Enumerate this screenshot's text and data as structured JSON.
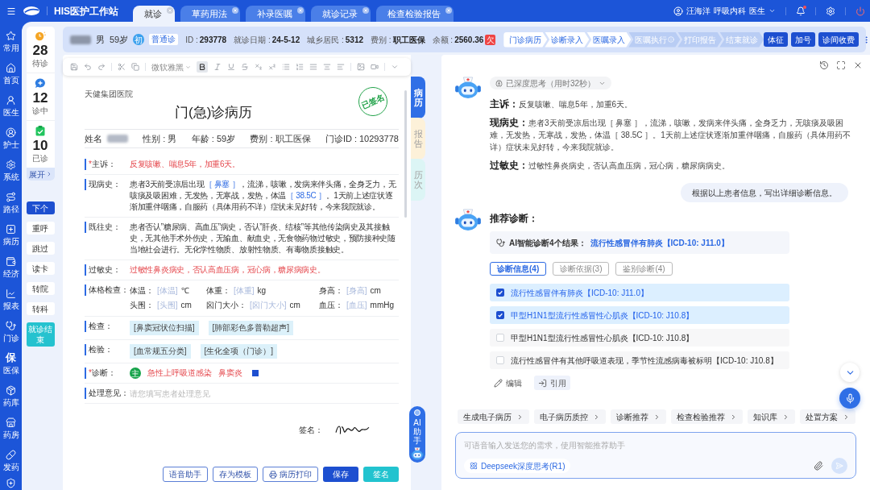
{
  "app": {
    "title": "HIS医护工作站"
  },
  "tabs": [
    {
      "label": "就诊",
      "selected": true
    },
    {
      "label": "草药用法",
      "selected": false
    },
    {
      "label": "补录医嘱",
      "selected": false
    },
    {
      "label": "就诊记录",
      "selected": false
    },
    {
      "label": "检查检验报告",
      "selected": false
    }
  ],
  "user": {
    "name": "汪海洋",
    "department": "呼吸内科",
    "role": "医生",
    "has_alert": true
  },
  "nav": [
    {
      "label": "常用"
    },
    {
      "label": "首页"
    },
    {
      "label": "医生"
    },
    {
      "label": "护士"
    },
    {
      "label": "系统"
    },
    {
      "label": "路径"
    },
    {
      "label": "病历"
    },
    {
      "label": "经济"
    },
    {
      "label": "报表"
    },
    {
      "label": "门诊"
    },
    {
      "label": "医保",
      "glyph": "保"
    },
    {
      "label": "药库"
    },
    {
      "label": "药房"
    },
    {
      "label": "发药"
    }
  ],
  "queue": {
    "stats": [
      {
        "count": "28",
        "label": "待诊"
      },
      {
        "count": "12",
        "label": "诊中"
      },
      {
        "count": "10",
        "label": "已诊"
      }
    ],
    "expand": "展开",
    "actions": [
      {
        "label": "下个",
        "kind": "primary"
      },
      {
        "label": "重呼",
        "kind": "plain"
      },
      {
        "label": "跳过",
        "kind": "plain"
      },
      {
        "label": "读卡",
        "kind": "plain"
      },
      {
        "label": "转院",
        "kind": "plain"
      },
      {
        "label": "转科",
        "kind": "plain"
      },
      {
        "label": "就诊结束",
        "kind": "finish"
      }
    ]
  },
  "patient": {
    "gender": "男",
    "age": "59岁",
    "visit_badge": "初",
    "visit_type": "普通诊",
    "fields": [
      {
        "label": "ID :",
        "value": "293778"
      },
      {
        "label": "就诊日期 :",
        "value": "24-5-12"
      },
      {
        "label": "城乡居民 :",
        "value": "5312"
      },
      {
        "label": "费别 :",
        "value": "职工医保"
      },
      {
        "label": "余额 :",
        "value": "2560.36"
      }
    ],
    "balance_badge": "欠"
  },
  "steps": [
    {
      "label": "门诊病历",
      "done": true,
      "info": false
    },
    {
      "label": "诊断录入",
      "done": true,
      "info": false
    },
    {
      "label": "医嘱录入",
      "done": true,
      "info": false
    },
    {
      "label": "医嘱执行",
      "done": false,
      "info": true
    },
    {
      "label": "打印报告",
      "done": false,
      "info": false
    },
    {
      "label": "结束就诊",
      "done": false,
      "info": false
    }
  ],
  "header_buttons": [
    "体征",
    "加号",
    "诊间收费"
  ],
  "toolbar": {
    "font": "微软雅黑",
    "bold": true
  },
  "document": {
    "hospital": "天健集团医院",
    "title": "门(急)诊病历",
    "stamp": "已签名",
    "info": [
      {
        "label": "姓名",
        "kind": "redacted"
      },
      {
        "label": "性别 :",
        "value": "男",
        "kind": "text"
      },
      {
        "label": "年龄 :",
        "value": "59岁",
        "kind": "text"
      },
      {
        "label": "费别 :",
        "value": "职工医保",
        "kind": "text"
      },
      {
        "label": "门诊ID :",
        "value": "10293778",
        "kind": "text"
      }
    ],
    "sections": [
      {
        "label": "主诉：",
        "required_mark": "*",
        "kind": "text",
        "alert": true,
        "text": "反复咳嗽、喘息5年，加重6天。"
      },
      {
        "label": "现病史：",
        "kind": "segments",
        "segments": [
          {
            "text": "患者3天前受凉后出现",
            "field": false
          },
          {
            "text": "［ 鼻塞 ］",
            "field": true
          },
          {
            "text": "，流涕，咳嗽，发病来伴头痛，全身乏力，无咳痰及吸困难，无发热，无寒战，发热，体温",
            "field": false
          },
          {
            "text": "［ 38.5C ］",
            "field": true
          },
          {
            "text": "。1天前上述症状逐渐加重伴咽痛，自服药（具体用药不详）症状未见好转，今来我院就诊。",
            "field": false
          }
        ]
      },
      {
        "label": "既往史：",
        "kind": "text",
        "alert": false,
        "text": "患者否认”糖尿病、高血压”病史，否认”肝炎、结核”等其他传染病史及其接触史，无其他手术外伤史，无输血、献血史，无食物药物过敏史，预防接种史随当地社会进行。无化学性物质、放射性物质、有毒物质接触史。"
      },
      {
        "label": "过敏史：",
        "kind": "text",
        "alert": true,
        "text": "过敏性鼻炎病史，否认高血压病，冠心病，糖尿病病史。"
      },
      {
        "label": "体格检查：",
        "kind": "vitals",
        "items": [
          {
            "label": "体温：",
            "placeholder": "[体温]",
            "unit": "℃"
          },
          {
            "label": "体重：",
            "placeholder": "[体重]",
            "unit": "kg"
          },
          {
            "label": "身高：",
            "placeholder": "[身高]",
            "unit": "cm"
          },
          {
            "label": "头围：",
            "placeholder": "[头围]",
            "unit": "cm"
          },
          {
            "label": "囟门大小：",
            "placeholder": "[囟门大小]",
            "unit": "cm"
          },
          {
            "label": "血压：",
            "placeholder": "[血压]",
            "unit": "mmHg"
          }
        ]
      },
      {
        "label": "检查：",
        "kind": "tags",
        "tags": [
          "[鼻窦冠状位扫描]",
          "[肺部彩色多普勒超声]"
        ]
      },
      {
        "label": "检验：",
        "kind": "tags",
        "tags": [
          "[血常规五分类]",
          "[生化全项（门诊）]"
        ]
      },
      {
        "label": "诊断：",
        "required_mark": "*",
        "kind": "diagnosis",
        "badge": "主",
        "items": [
          "急性上呼吸道感染",
          "鼻窦炎"
        ]
      },
      {
        "label": "处理意见：",
        "kind": "input",
        "placeholder": "请您填写患者处理意见"
      }
    ],
    "signature_label": "签名："
  },
  "side_tabs": [
    {
      "label": "病历",
      "selected": true,
      "color": "#2f6fe6"
    },
    {
      "label": "报告",
      "selected": false,
      "color": "#fdf1d9"
    },
    {
      "label": "历次",
      "selected": false,
      "color": "#dcf5f5"
    }
  ],
  "doc_buttons": [
    {
      "label": "语音助手",
      "kind": "outline"
    },
    {
      "label": "存为模板",
      "kind": "outline"
    },
    {
      "label": "病历打印",
      "kind": "print"
    },
    {
      "label": "保存",
      "kind": "primary"
    },
    {
      "label": "签名",
      "kind": "accent"
    }
  ],
  "ai_widget": {
    "label": "AI助手"
  },
  "assistant": {
    "thinking": "已深度思考（用时32秒）",
    "summary": [
      {
        "label": "主诉：",
        "text": "反复咳嗽、喘息5年，加重6天。"
      },
      {
        "label": "现病史：",
        "text": "患者3天前受凉后出现［ 鼻塞 ］，流涕，咳嗽，发病来伴头痛，全身乏力，无咳痰及吸困难，无发热，无寒战，发热，体温［ 38.5C ］。1天前上述症状逐渐加重伴咽痛，自服药（具体用药不详）症状未见好转，今来我院就诊。"
      },
      {
        "label": "过敏史：",
        "text": "过敏性鼻炎病史，否认高血压病，冠心病，糖尿病病史。"
      }
    ],
    "user_message": "根据以上患者信息，写出详细诊断信息。",
    "recommend_title": "推荐诊断：",
    "result_lead": "AI智能诊断4个结果：",
    "result_top": "流行性感冒伴有肺炎【ICD-10: J11.0】",
    "result_tabs": [
      {
        "label": "诊断信息(4)",
        "selected": true
      },
      {
        "label": "诊断依据(3)",
        "selected": false
      },
      {
        "label": "鉴别诊断(4)",
        "selected": false
      }
    ],
    "diagnoses": [
      {
        "text": "流行性感冒伴有肺炎【ICD-10: J11.0】",
        "checked": true
      },
      {
        "text": "甲型H1N1型流行性感冒性心肌炎【ICD-10: J10.8】",
        "checked": true
      },
      {
        "text": "甲型H1N1型流行性感冒性心肌炎【ICD-10: J10.8】",
        "checked": false
      },
      {
        "text": "流行性感冒伴有其他呼吸道表现，季节性流感病毒被标明【ICD-10: J10.8】",
        "checked": false
      }
    ],
    "actions": [
      "编辑",
      "引用"
    ],
    "quick_actions": [
      "生成电子病历",
      "电子病历质控",
      "诊断推荐",
      "检查检验推荐",
      "知识库",
      "处置方案"
    ],
    "input": {
      "placeholder": "可语音输入发送您的需求，使用智能推荐助手",
      "model": "Deepseek深度思考(R1)"
    }
  }
}
